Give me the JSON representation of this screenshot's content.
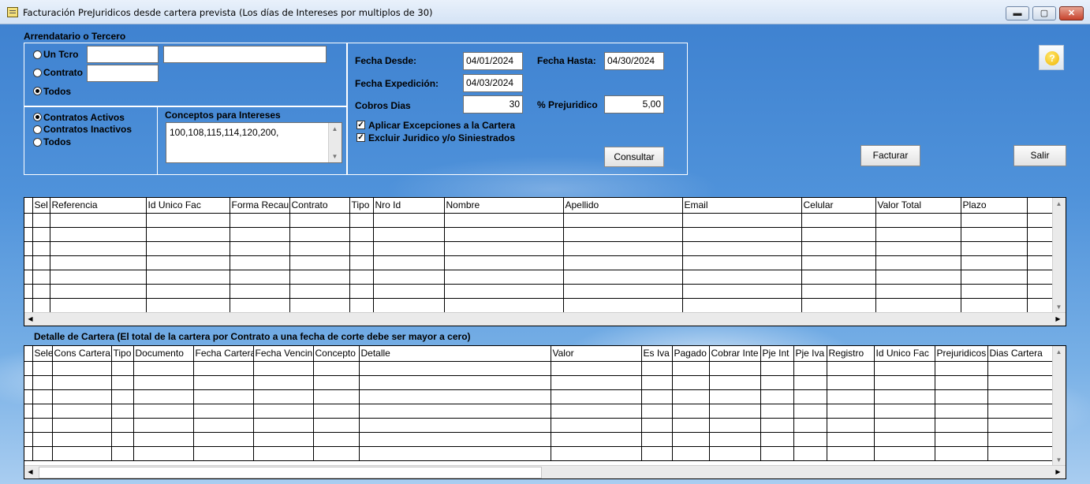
{
  "window": {
    "title": "Facturación PreJuridicos desde cartera prevista (Los días de Intereses por multiplos de 30)",
    "min_label": "▬",
    "max_label": "▢",
    "close_label": "✕"
  },
  "tercero": {
    "group_label": "Arrendatario o Tercero",
    "options": [
      {
        "label": "Un Tcro",
        "selected": false
      },
      {
        "label": "Contrato",
        "selected": false
      },
      {
        "label": "Todos",
        "selected": true
      }
    ],
    "tcro_code": "",
    "tcro_name": "",
    "contrato_value": ""
  },
  "contratos": {
    "options": [
      {
        "label": "Contratos Activos",
        "selected": true
      },
      {
        "label": "Contratos Inactivos",
        "selected": false
      },
      {
        "label": "Todos",
        "selected": false
      }
    ]
  },
  "conceptos": {
    "label": "Conceptos para Intereses",
    "value": "100,108,115,114,120,200,"
  },
  "filters": {
    "fecha_desde_label": "Fecha Desde:",
    "fecha_desde": "04/01/2024",
    "fecha_hasta_label": "Fecha Hasta:",
    "fecha_hasta": "04/30/2024",
    "fecha_expedicion_label": "Fecha Expedición:",
    "fecha_expedicion": "04/03/2024",
    "cobros_dias_label": "Cobros Dias",
    "cobros_dias": "30",
    "prejuridico_label": "% Prejuridico",
    "prejuridico": "5,00",
    "aplicar_label": "Aplicar Excepciones a la Cartera",
    "aplicar_checked": true,
    "excluir_label": "Excluir Juridico y/o Siniestrados",
    "excluir_checked": true,
    "consultar_label": "Consultar"
  },
  "actions": {
    "facturar_label": "Facturar",
    "salir_label": "Salir",
    "help_label": "?"
  },
  "grid1": {
    "columns": [
      "Sel",
      "Referencia",
      "Id Unico Fac",
      "Forma Recau",
      "Contrato",
      "Tipo",
      "Nro Id",
      "Nombre",
      "Apellido",
      "Email",
      "Celular",
      "Valor Total",
      "Plazo"
    ],
    "rows": 7
  },
  "detalle": {
    "label": "Detalle de Cartera (El total de la cartera por Contrato a una fecha de corte debe ser mayor a cero)"
  },
  "grid2": {
    "columns": [
      "Sele",
      "Cons Cartera",
      "Tipo",
      "Documento",
      "Fecha Cartera",
      "Fecha Vencin",
      "Concepto",
      "Detalle",
      "Valor",
      "Es Iva",
      "Pagado",
      "Cobrar Inte",
      "Pje Int",
      "Pje Iva",
      "Registro",
      "Id Unico Fac",
      "Prejuridicos",
      "Dias Cartera"
    ],
    "rows": 7
  },
  "colors": {
    "accent": "#3d80cf"
  },
  "icons": {
    "app": "app-icon",
    "help": "help-icon"
  }
}
